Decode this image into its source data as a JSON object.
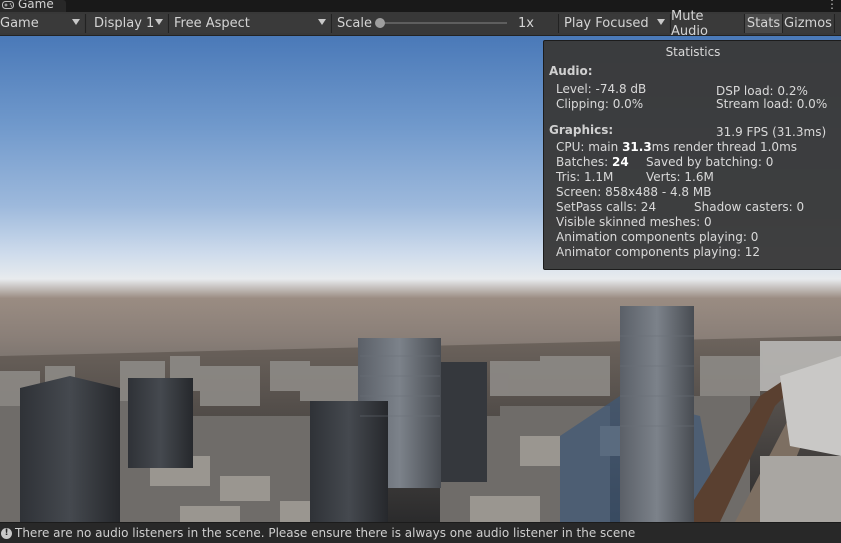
{
  "tab": {
    "label": "Game",
    "icon": "gamepad-icon"
  },
  "toolbar": {
    "display_mode": "Game",
    "display": "Display 1",
    "aspect": "Free Aspect",
    "scale_label": "Scale",
    "scale_value": "1x",
    "play_mode": "Play Focused",
    "mute_audio": "Mute Audio",
    "stats": "Stats",
    "gizmos": "Gizmos"
  },
  "statistics": {
    "title": "Statistics",
    "audio": {
      "header": "Audio:",
      "level": "Level: -74.8 dB",
      "clipping": "Clipping: 0.0%",
      "dsp_load": "DSP load: 0.2%",
      "stream_load": "Stream load: 0.0%"
    },
    "graphics": {
      "header": "Graphics:",
      "fps": "31.9 FPS (31.3ms)",
      "cpu_prefix": "CPU: main ",
      "cpu_main": "31.3",
      "cpu_suffix": "ms  render thread 1.0ms",
      "batches_prefix": "Batches: ",
      "batches": "24",
      "saved_by_batching": "Saved by batching: 0",
      "tris": "Tris: 1.1M",
      "verts": "Verts: 1.6M",
      "screen": "Screen: 858x488 - 4.8 MB",
      "setpass": "SetPass calls: 24",
      "shadow_casters": "Shadow casters: 0",
      "skinned_meshes": "Visible skinned meshes: 0",
      "animation_components": "Animation components playing: 0",
      "animator_components": "Animator components playing: 12"
    }
  },
  "status": {
    "icon": "info-icon",
    "message": "There are no audio listeners in the scene. Please ensure there is always one audio listener in the scene"
  }
}
